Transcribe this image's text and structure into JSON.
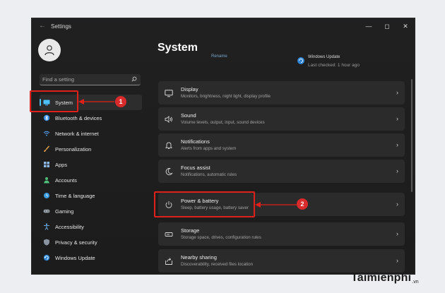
{
  "window": {
    "title": "Settings",
    "controls": [
      "minimize",
      "maximize",
      "close"
    ]
  },
  "search": {
    "placeholder": "Find a setting",
    "value": ""
  },
  "sidebar": {
    "items": [
      {
        "label": "System",
        "icon": "system-icon",
        "active": true
      },
      {
        "label": "Bluetooth & devices",
        "icon": "bluetooth-icon"
      },
      {
        "label": "Network & internet",
        "icon": "wifi-icon"
      },
      {
        "label": "Personalization",
        "icon": "brush-icon"
      },
      {
        "label": "Apps",
        "icon": "apps-icon"
      },
      {
        "label": "Accounts",
        "icon": "person-icon"
      },
      {
        "label": "Time & language",
        "icon": "globe-clock-icon"
      },
      {
        "label": "Gaming",
        "icon": "gamepad-icon"
      },
      {
        "label": "Accessibility",
        "icon": "accessibility-icon"
      },
      {
        "label": "Privacy & security",
        "icon": "shield-icon"
      },
      {
        "label": "Windows Update",
        "icon": "update-icon"
      }
    ]
  },
  "main": {
    "title": "System",
    "top_partial": {
      "left": "Rename",
      "update_title": "Windows Update",
      "update_sub": "Last checked: 1 hour ago"
    },
    "cards": [
      {
        "title": "Display",
        "subtitle": "Monitors, brightness, night light, display profile",
        "icon": "display-icon"
      },
      {
        "title": "Sound",
        "subtitle": "Volume levels, output, input, sound devices",
        "icon": "sound-icon"
      },
      {
        "title": "Notifications",
        "subtitle": "Alerts from apps and system",
        "icon": "bell-icon"
      },
      {
        "title": "Focus assist",
        "subtitle": "Notifications, automatic rules",
        "icon": "moon-icon"
      },
      {
        "title": "Power & battery",
        "subtitle": "Sleep, battery usage, battery saver",
        "icon": "power-icon"
      },
      {
        "title": "Storage",
        "subtitle": "Storage space, drives, configuration rules",
        "icon": "storage-icon"
      },
      {
        "title": "Nearby sharing",
        "subtitle": "Discoverability, received files location",
        "icon": "share-icon"
      }
    ]
  },
  "annotations": {
    "step1": "1",
    "step2": "2"
  },
  "watermark": {
    "brand": "Taimienphi",
    "tld": ".vn"
  },
  "colors": {
    "accent": "#4cc2ff",
    "highlight": "#e0201b",
    "window_bg": "#202020",
    "card_bg": "#2b2b2b"
  }
}
